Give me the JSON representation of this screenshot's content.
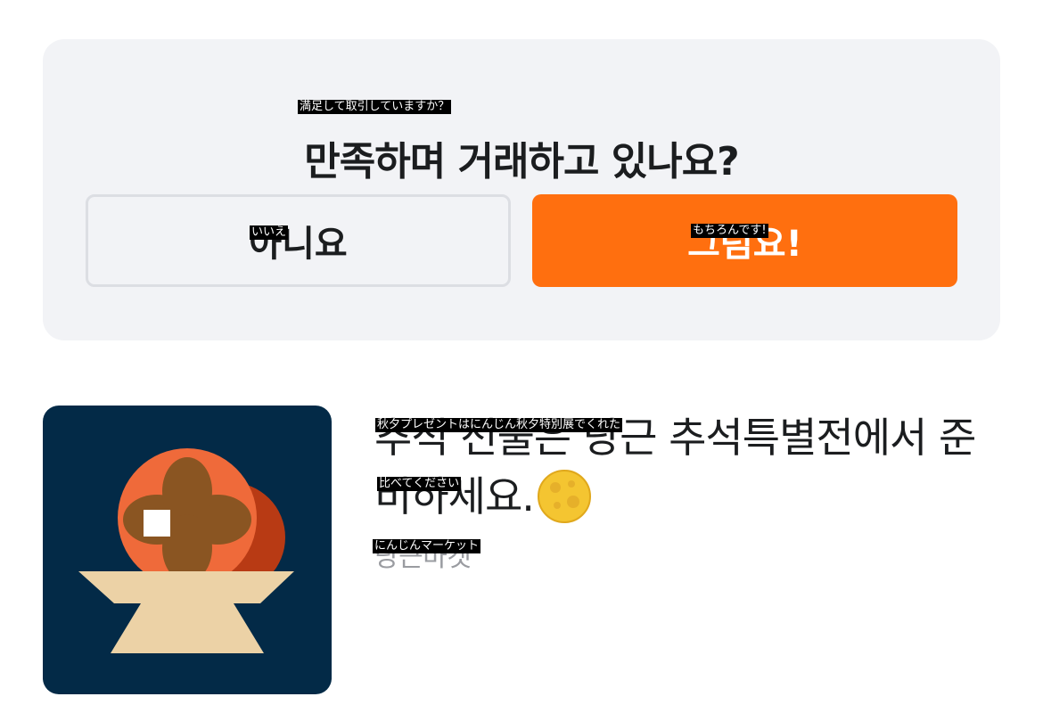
{
  "survey": {
    "title": "만족하며 거래하고 있나요?",
    "title_overlay": "満足して取引していますか？",
    "no_label": "아니요",
    "no_overlay": "いいえ",
    "yes_label": "그럼요!",
    "yes_overlay": "もちろんです!"
  },
  "post": {
    "title_line1": "추석 선물은 당근 추석특별전에서 준",
    "title_line2": "비하세요.",
    "title_overlay1": "秋夕プレゼントはにんじん秋夕特別展でくれた",
    "title_overlay2": "比べてください",
    "source": "당근마켓",
    "source_overlay": "にんじんマーケット",
    "emoji": "moon-icon"
  },
  "colors": {
    "accent": "#ff6f0f",
    "card_bg": "#f2f3f6",
    "thumb_bg": "#032a47"
  }
}
